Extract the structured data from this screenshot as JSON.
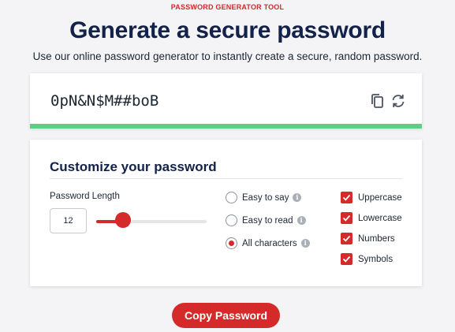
{
  "header": {
    "eyebrow": "PASSWORD GENERATOR TOOL",
    "title": "Generate a secure password",
    "subtitle": "Use our online password generator to instantly create a secure, random password."
  },
  "password": {
    "value": "0pN&N$M##boB",
    "strength_fraction": 1.0,
    "strength_color": "#5ccf84",
    "copy_icon": "copy-icon",
    "refresh_icon": "refresh-icon"
  },
  "customize": {
    "title": "Customize your password",
    "length_label": "Password Length",
    "length_value": "12",
    "slider_fraction": 0.24,
    "character_modes": [
      {
        "label": "Easy to say",
        "selected": false
      },
      {
        "label": "Easy to read",
        "selected": false
      },
      {
        "label": "All characters",
        "selected": true
      }
    ],
    "options": [
      {
        "label": "Uppercase",
        "checked": true
      },
      {
        "label": "Lowercase",
        "checked": true
      },
      {
        "label": "Numbers",
        "checked": true
      },
      {
        "label": "Symbols",
        "checked": true
      }
    ]
  },
  "actions": {
    "copy_label": "Copy Password"
  },
  "colors": {
    "accent": "#d52a2a",
    "heading": "#13224a"
  }
}
